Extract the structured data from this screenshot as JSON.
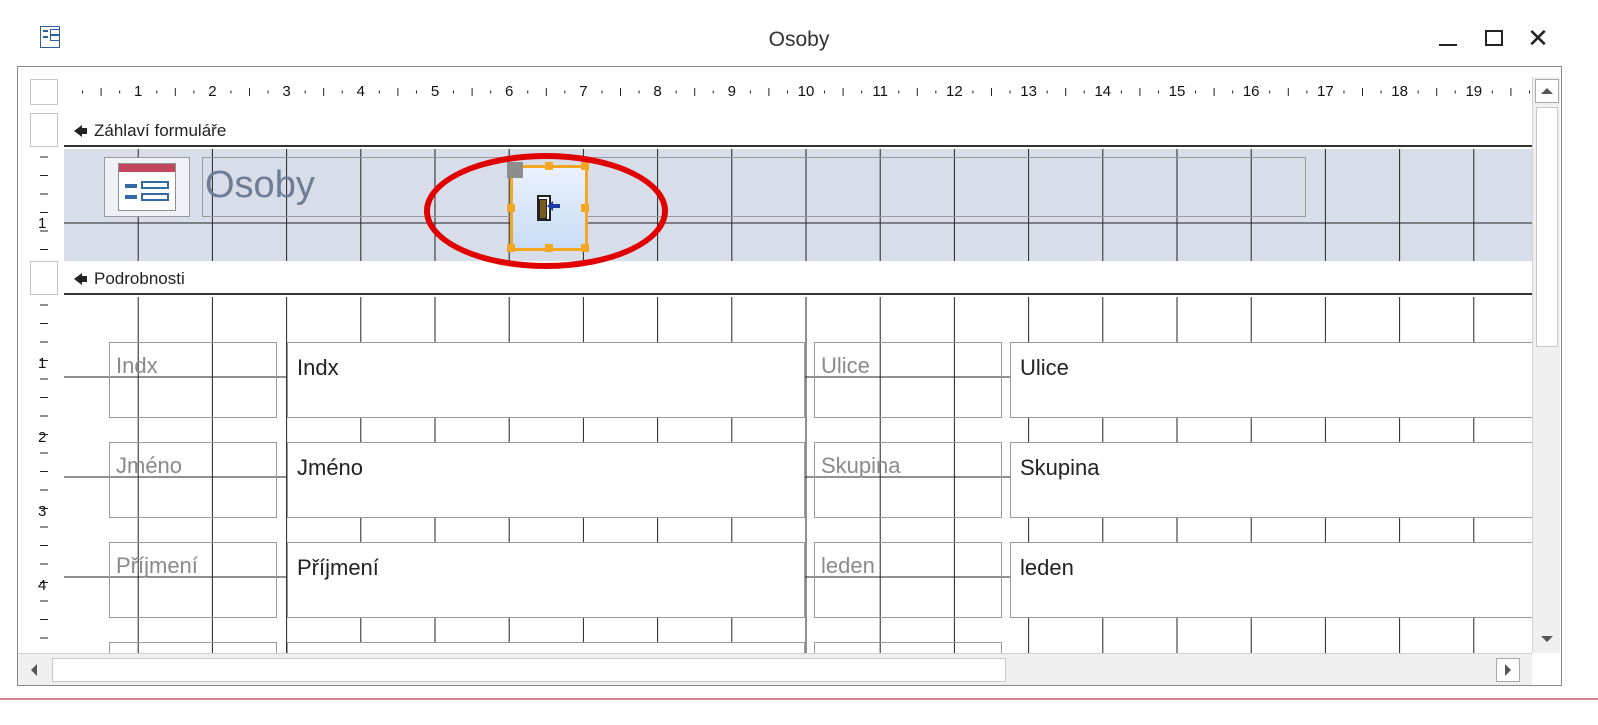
{
  "window": {
    "title": "Osoby",
    "app_icon": "form-icon",
    "controls": {
      "minimize": "minimize-icon",
      "maximize": "maximize-icon",
      "close": "close-icon",
      "close_glyph": "✕"
    }
  },
  "ruler": {
    "horizontal_numbers": [
      "1",
      "2",
      "3",
      "4",
      "5",
      "6",
      "7",
      "8",
      "9",
      "10",
      "11",
      "12",
      "13",
      "14",
      "15",
      "16",
      "17",
      "18",
      "19"
    ],
    "vertical_header_numbers": [
      "1"
    ],
    "vertical_detail_numbers": [
      "1",
      "2",
      "3",
      "4"
    ]
  },
  "sections": {
    "header_label": "Záhlaví formuláře",
    "detail_label": "Podrobnosti"
  },
  "header": {
    "title": "Osoby",
    "logo_icon": "form-logo-icon",
    "button_icon": "exit-door-icon"
  },
  "detail": {
    "left_rows": [
      {
        "label": "Indx",
        "field": "Indx"
      },
      {
        "label": "Jméno",
        "field": "Jméno"
      },
      {
        "label": "Příjmení",
        "field": "Příjmení"
      }
    ],
    "right_rows": [
      {
        "label": "Ulice",
        "field": "Ulice"
      },
      {
        "label": "Skupina",
        "field": "Skupina"
      },
      {
        "label": "leden",
        "field": "leden"
      }
    ]
  },
  "colors": {
    "header_background": "#d7dee9",
    "selection": "#f5a623",
    "highlight_ellipse": "#e00000"
  }
}
